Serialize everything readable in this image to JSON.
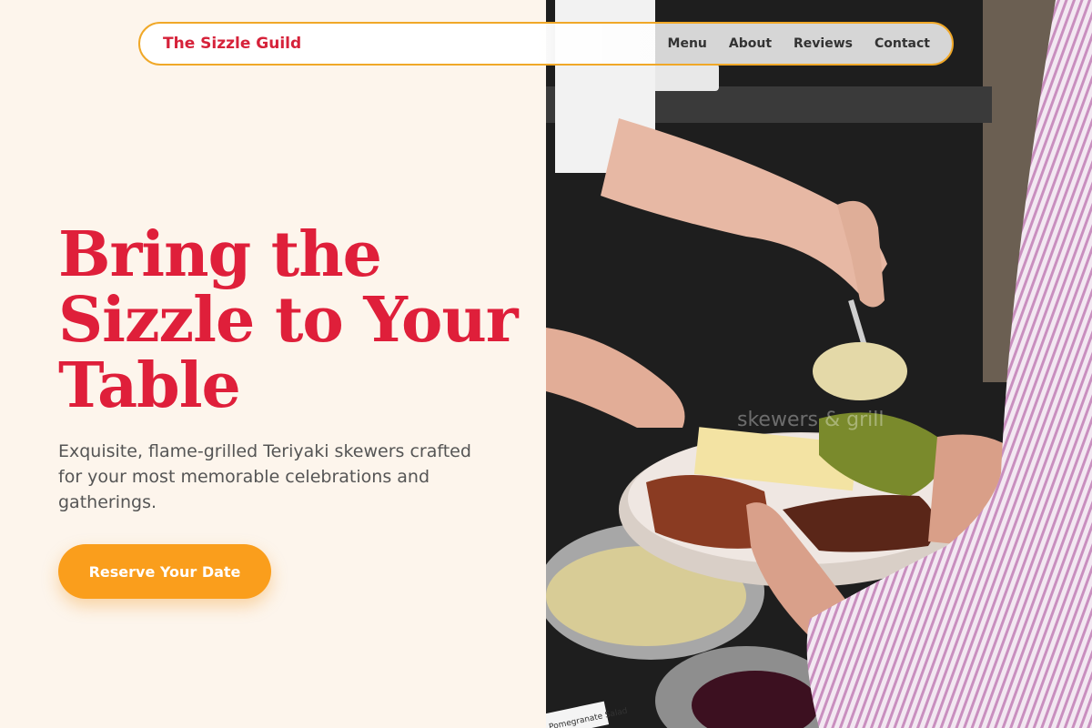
{
  "nav": {
    "brand": "The Sizzle Guild",
    "links": [
      "Menu",
      "About",
      "Reviews",
      "Contact"
    ]
  },
  "hero": {
    "title_lines": [
      "Bring the",
      "Sizzle to Your",
      "Table"
    ],
    "subtitle": "Exquisite, flame-grilled Teriyaki skewers crafted for your most memorable celebrations and gatherings.",
    "cta_label": "Reserve Your Date"
  },
  "photo": {
    "label_text": "Pomegranate Salad",
    "watermark": "skewers & grill"
  },
  "colors": {
    "brand_red": "#df1f3a",
    "accent_orange": "#fa9e1c",
    "nav_border": "#f0a828",
    "background": "#fdf5ec"
  }
}
